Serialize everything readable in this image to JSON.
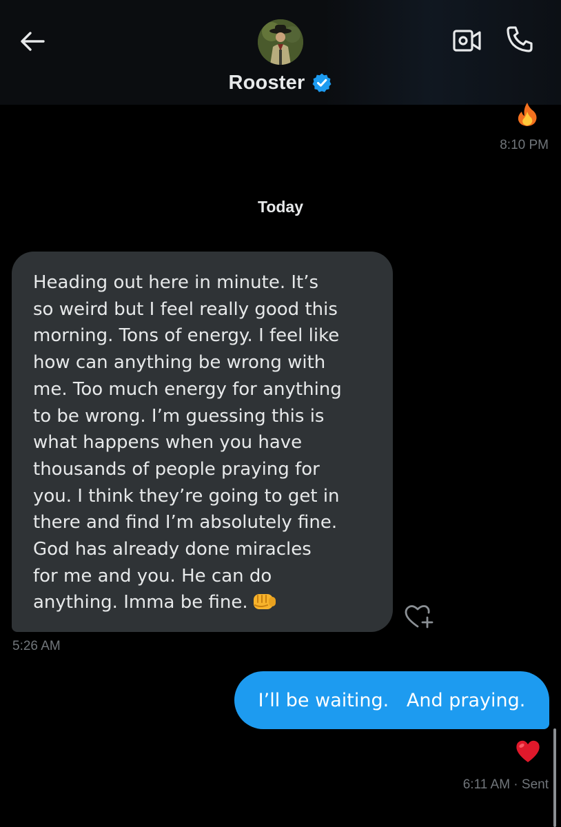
{
  "header": {
    "back_icon": "arrow-left-icon",
    "contact_name": "Rooster",
    "verified_icon": "verified-badge-icon",
    "video_icon": "video-camera-icon",
    "call_icon": "phone-icon"
  },
  "thread": {
    "earlier": {
      "reaction_icon": "fire-emoji",
      "time": "8:10 PM"
    },
    "day_separator": "Today",
    "incoming": {
      "text": "Heading out here in minute. It’s\nso weird but I feel really good this\nmorning. Tons of energy. I feel like\nhow can anything be wrong with\nme. Too much energy for anything\nto be wrong. I’m guessing this is\nwhat happens when you have\nthousands of people praying for\nyou. I think they’re going to get in\nthere and find I’m absolutely fine.\nGod has already done miracles\nfor me and you. He can do\nanything. Imma be fine.",
      "emoji": "oncoming-fist-emoji",
      "time": "5:26 AM",
      "react_icon": "heart-plus-icon"
    },
    "outgoing": {
      "text": "I’ll be waiting.   And praying.",
      "reaction_icon": "red-heart-emoji",
      "time": "6:11 AM · Sent"
    }
  },
  "colors": {
    "background": "#000000",
    "header_background": "#0b0d10",
    "incoming_bubble": "#2f3336",
    "outgoing_bubble": "#1d9bf0",
    "verified_blue": "#1d9bf0",
    "muted_text": "#71767b",
    "heart_red": "#e0192b"
  }
}
